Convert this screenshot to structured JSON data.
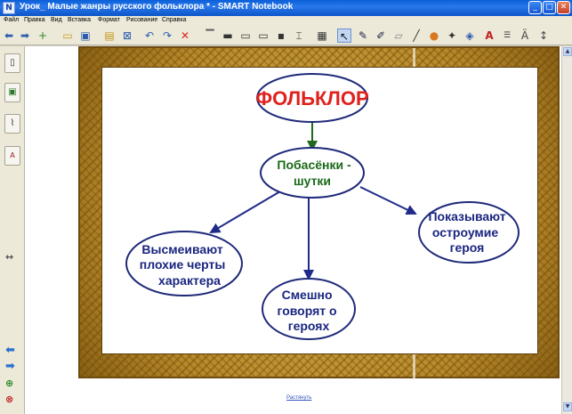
{
  "window": {
    "title": "Урок_ Малые жанры русского фольклора * - SMART Notebook",
    "app_icon": "smart-notebook-icon"
  },
  "menu": [
    "Файл",
    "Правка",
    "Вид",
    "Вставка",
    "Формат",
    "Рисование",
    "Справка"
  ],
  "toolbar_icons": [
    "back-icon",
    "forward-icon",
    "add-page-icon",
    "open-icon",
    "save-icon",
    "paste-icon",
    "clear-icon",
    "undo-icon",
    "redo-icon",
    "delete-icon",
    "screen-shade-icon",
    "display-icon",
    "monitor-icon",
    "monitor-2-icon",
    "camera-icon",
    "capture-icon",
    "table-icon",
    "select-icon",
    "pen-icon",
    "creative-pen-icon",
    "eraser-icon",
    "line-icon",
    "shape-icon",
    "magic-pen-icon",
    "fill-icon",
    "text-icon",
    "properties-icon",
    "font-icon",
    "move-toolbar-icon"
  ],
  "sidebar_tabs": [
    "page-sorter-icon",
    "gallery-icon",
    "attachments-icon",
    "properties-icon"
  ],
  "diagram": {
    "root": "ФОЛЬКЛОР",
    "center": [
      "Побасёнки -",
      "шутки"
    ],
    "left": [
      "Высмеивают",
      "плохие черты",
      "характера"
    ],
    "bottom": [
      "Смешно",
      "говорят о",
      "героях"
    ],
    "right": [
      "Показывают",
      "остроумие",
      "героя"
    ]
  },
  "colors": {
    "root_text": "#e0201c",
    "ellipse_stroke": "#1f2a7a",
    "center_text": "#1a6a1a",
    "node_text": "#1a2580",
    "arrow_green": "#1f6a1f",
    "arrow_blue": "#1f2a8a"
  },
  "footer_link": "Растянуть"
}
